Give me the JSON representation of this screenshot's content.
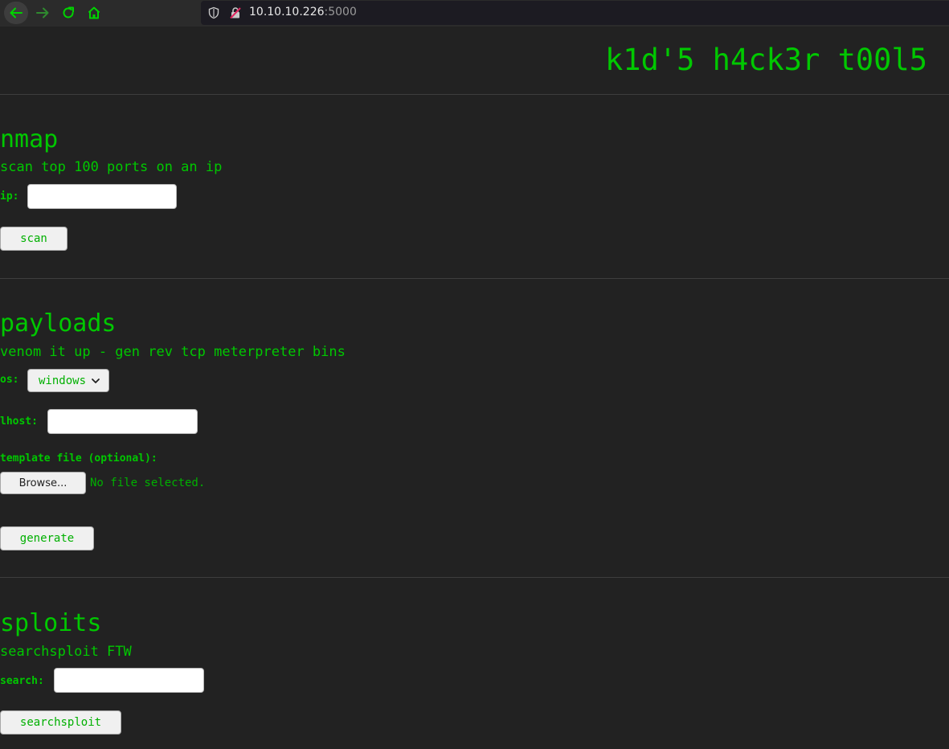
{
  "browser": {
    "url_host": "10.10.10.226",
    "url_port": ":5000"
  },
  "colors": {
    "accent": "#00c800",
    "background": "#222222"
  },
  "page": {
    "title": "k1d'5 h4ck3r t00l5"
  },
  "nmap": {
    "heading": "nmap",
    "description": "scan top 100 ports on an ip",
    "ip_label": "ip:",
    "ip_value": "",
    "button": "scan"
  },
  "payloads": {
    "heading": "payloads",
    "description": "venom it up - gen rev tcp meterpreter bins",
    "os_label": "os:",
    "os_selected": "windows",
    "lhost_label": "lhost:",
    "lhost_value": "",
    "template_label": "template file (optional):",
    "browse_button": "Browse...",
    "no_file": "No file selected.",
    "button": "generate"
  },
  "sploits": {
    "heading": "sploits",
    "description": "searchsploit FTW",
    "search_label": "search:",
    "search_value": "",
    "button": "searchsploit"
  }
}
